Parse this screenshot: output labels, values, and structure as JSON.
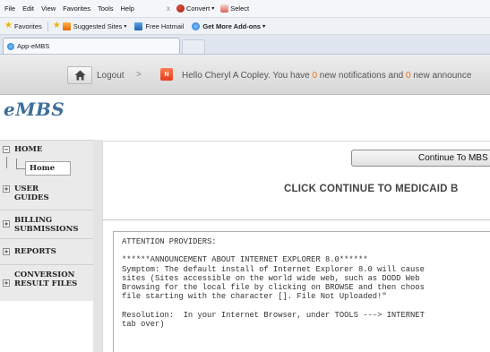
{
  "browser": {
    "menu": [
      "File",
      "Edit",
      "View",
      "Favorites",
      "Tools",
      "Help"
    ],
    "close_glyph": "x",
    "toolbar": {
      "convert_label": "Convert",
      "select_label": "Select",
      "convert_icon": "pdf-convert-icon",
      "select_icon": "pdf-select-icon"
    },
    "favorites": {
      "favorites_label": "Favorites",
      "items": [
        "Suggested Sites",
        "Free Hotmail",
        "Get More Add-ons"
      ]
    },
    "tab": {
      "title": "App-eMBS",
      "icon": "ie-page-icon"
    }
  },
  "header": {
    "home_icon": "home-icon",
    "logout_label": "Logout",
    "chevron": ">",
    "notif_badge": "N",
    "greeting_prefix": "Hello Cheryl A Copley. You have ",
    "notifications_count": "0",
    "greeting_middle": " new notifications and ",
    "announcements_count": "0",
    "greeting_suffix": " new announce"
  },
  "logo": {
    "text": "eMBS"
  },
  "sidebar": {
    "items": [
      {
        "label": "HOME",
        "expander": "−"
      },
      {
        "label": "USER GUIDES",
        "expander": "+"
      },
      {
        "label": "BILLING SUBMISSIONS",
        "expander": "+"
      },
      {
        "label": "REPORTS",
        "expander": "+"
      },
      {
        "label": "CONVERSION RESULT FILES",
        "expander": "+"
      }
    ],
    "home_child": "Home"
  },
  "main": {
    "continue_label": "Continue To MBS",
    "heading": "CLICK CONTINUE TO MEDICAID B",
    "notice_text": "ATTENTION PROVIDERS:\n\n******ANNOUNCEMENT ABOUT INTERNET EXPLORER 8.0******\nSymptom: The default install of Internet Explorer 8.0 will cause\nsites (Sites accessible on the world wide web, such as DODD Web\nBrowsing for the local file by clicking on BROWSE and then choos\nfile starting with the character []. File Not Uploaded!\"\n\nResolution:  In your Internet Browser, under TOOLS ---> INTERNET\ntab over)\n"
  },
  "colors": {
    "accent_orange": "#ff6a00",
    "logo_blue": "#3e6f9c"
  }
}
